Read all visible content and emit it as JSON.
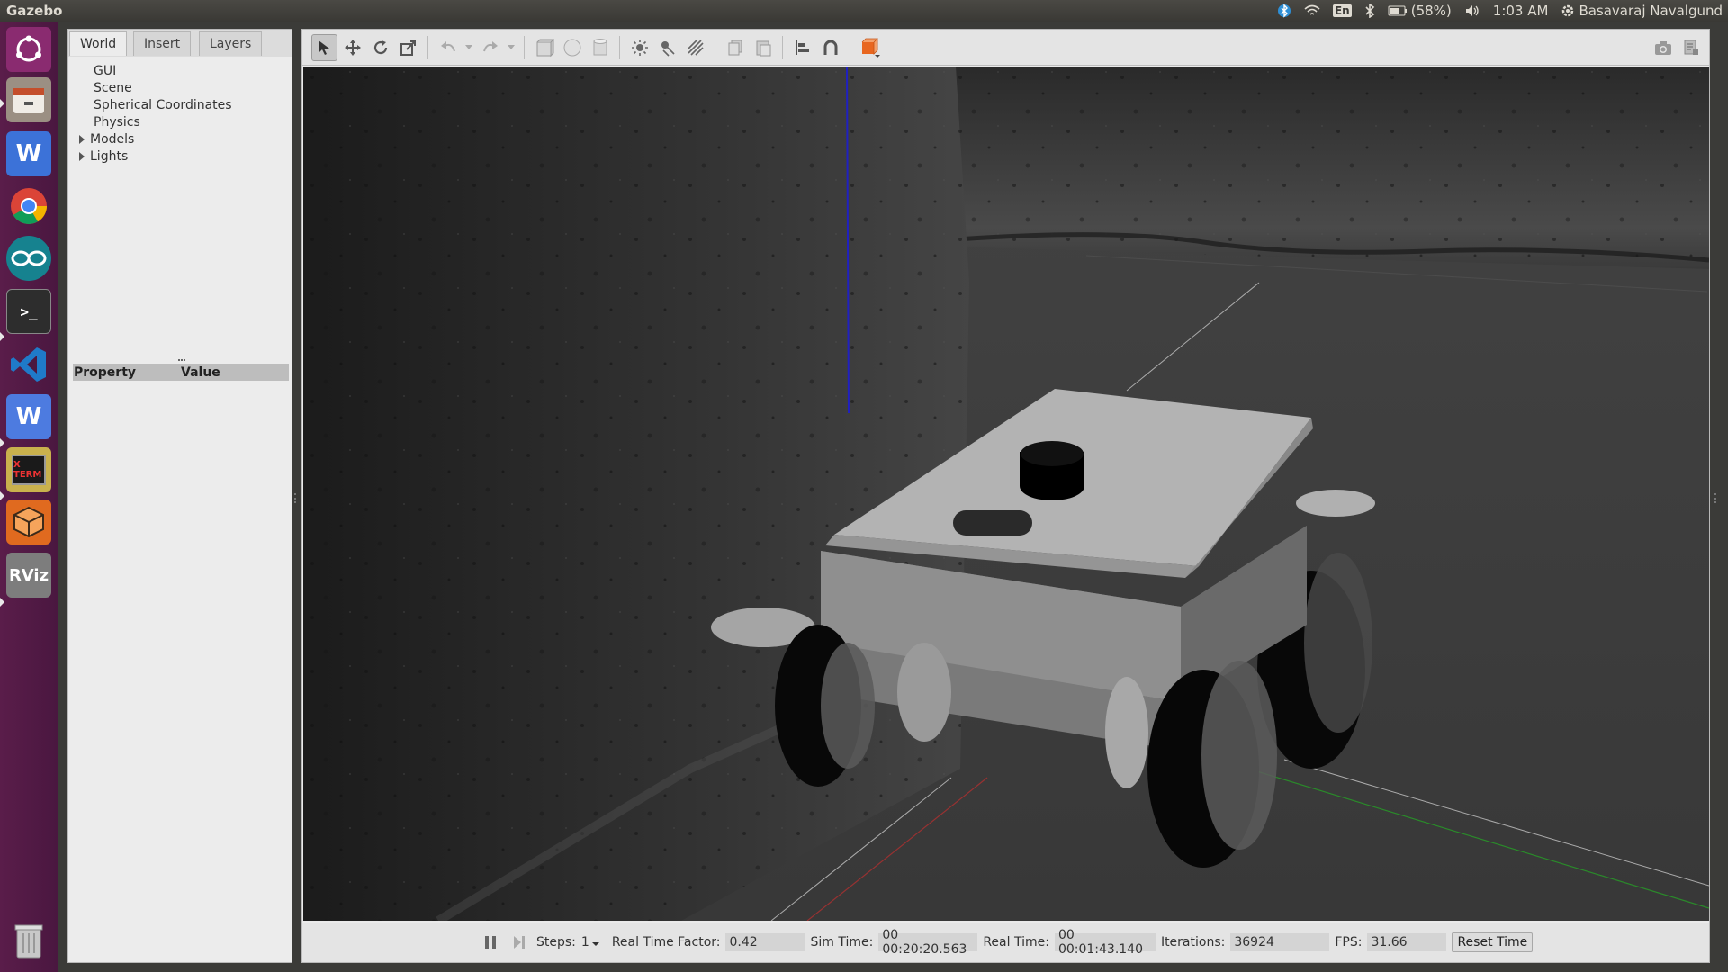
{
  "top_panel": {
    "app_title": "Gazebo",
    "keyboard_layout": "En",
    "battery": "(58%)",
    "clock": "1:03 AM",
    "user_name": "Basavaraj Navalgund"
  },
  "launcher": {
    "items": [
      "ubuntu-dash-icon",
      "files-icon",
      "wps-writer-icon",
      "chrome-icon",
      "arduino-icon",
      "terminal-icon",
      "vscode-icon",
      "wps-writer-icon",
      "xterm-icon",
      "package-icon",
      "rviz-icon",
      "trash-icon"
    ],
    "rviz_label": "RViz",
    "xterm_label": "X TERM"
  },
  "left_panel": {
    "tabs": [
      "World",
      "Insert",
      "Layers"
    ],
    "tree": [
      "GUI",
      "Scene",
      "Spherical Coordinates",
      "Physics",
      "Models",
      "Lights"
    ],
    "property_header": "Property",
    "value_header": "Value"
  },
  "statusbar": {
    "steps_label": "Steps:",
    "steps_value": "1",
    "rtf_label": "Real Time Factor:",
    "rtf_value": "0.42",
    "sim_time_label": "Sim Time:",
    "sim_time_value": "00 00:20:20.563",
    "real_time_label": "Real Time:",
    "real_time_value": "00 00:01:43.140",
    "iterations_label": "Iterations:",
    "iterations_value": "36924",
    "fps_label": "FPS:",
    "fps_value": "31.66",
    "reset_label": "Reset Time"
  },
  "colors": {
    "launcher_bg": "#4a1740",
    "accent_orange": "#e8661f"
  }
}
